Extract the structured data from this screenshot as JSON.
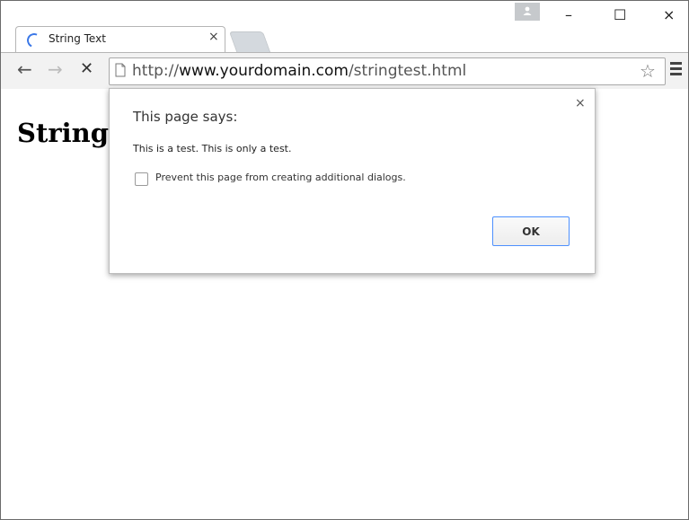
{
  "tab": {
    "title": "String Text",
    "close_glyph": "×"
  },
  "window_controls": {
    "minimize": "–",
    "maximize": "☐",
    "close": "×"
  },
  "toolbar": {
    "back_glyph": "←",
    "forward_glyph": "→",
    "stop_glyph": "✕",
    "url_scheme": "http://",
    "url_domain": "www.yourdomain.com",
    "url_path": "/stringtest.html",
    "star_glyph": "☆"
  },
  "page": {
    "heading": "String"
  },
  "dialog": {
    "close_glyph": "×",
    "title": "This page says:",
    "message": "This is a test. This is only a test.",
    "checkbox_label": "Prevent this page from creating additional dialogs.",
    "checkbox_checked": false,
    "ok_label": "OK"
  },
  "colors": {
    "accent": "#4d90fe",
    "spinner": "#3b78e7",
    "toolbar_bg": "#f2f2f2"
  },
  "icons": [
    "loading-spinner-icon",
    "profile-icon",
    "back-arrow-icon",
    "forward-arrow-icon",
    "stop-icon",
    "page-icon",
    "star-icon",
    "menu-icon",
    "close-icon"
  ]
}
